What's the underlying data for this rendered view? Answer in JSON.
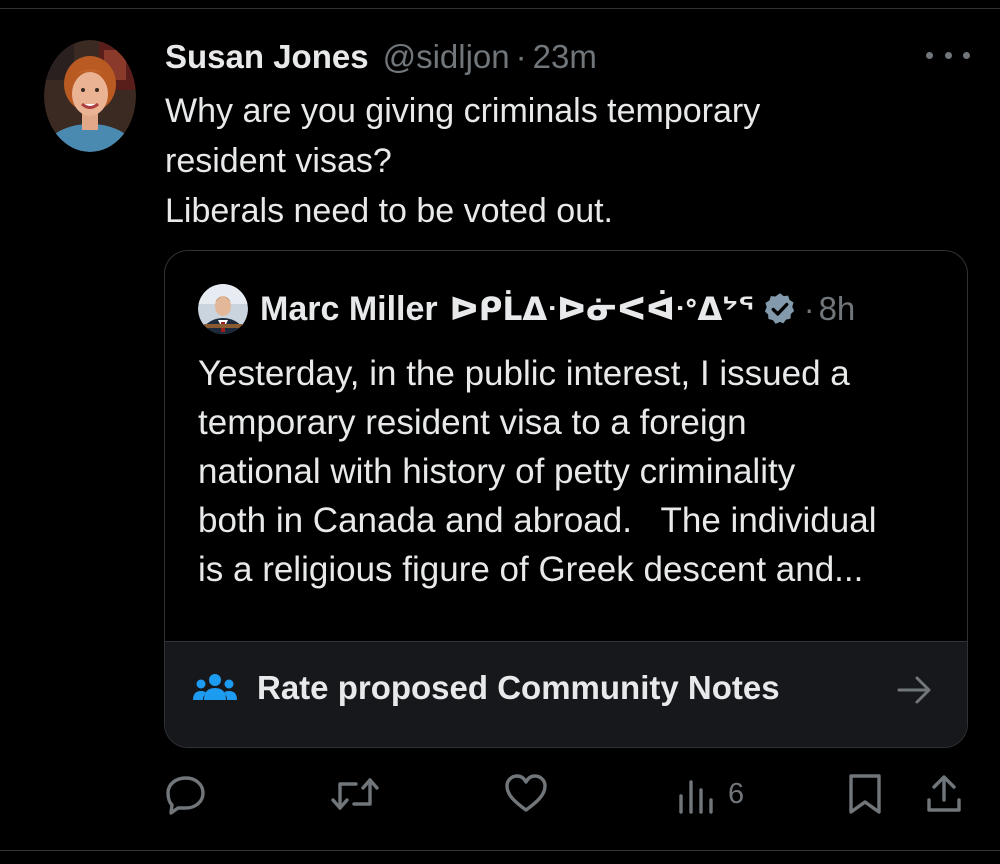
{
  "tweet": {
    "author_name": "Susan Jones",
    "author_handle": "@sidljon",
    "separator": "·",
    "time": "23m",
    "text_lines": [
      "Why are you giving criminals temporary",
      "resident visas?",
      "Liberals need to be voted out."
    ]
  },
  "quote": {
    "author_name": "Marc Miller",
    "author_syllabics": "ᐅᑭᒫᐃᐧᐅᓃᐸᐋᐧᐤᐃᔾᕐ",
    "separator": "·",
    "time": "8h",
    "text_lines": [
      "Yesterday, in the public interest, I issued a",
      "temporary resident visa to a foreign",
      "national with history of petty criminality",
      "both in Canada and abroad.   The individual",
      "is a religious figure of Greek descent and..."
    ],
    "verified_icon": "verified-badge-icon"
  },
  "community_notes": {
    "label": "Rate proposed Community Notes",
    "icon": "people-icon",
    "arrow_icon": "arrow-right-icon"
  },
  "actions": {
    "reply_icon": "reply-icon",
    "retweet_icon": "retweet-icon",
    "like_icon": "heart-icon",
    "views_icon": "views-icon",
    "views_count": "6",
    "bookmark_icon": "bookmark-icon",
    "share_icon": "share-icon"
  },
  "colors": {
    "background": "#000000",
    "text": "#e7e9ea",
    "muted": "#71767b",
    "accent_blue": "#1d9bf0",
    "border": "#2f3336"
  }
}
